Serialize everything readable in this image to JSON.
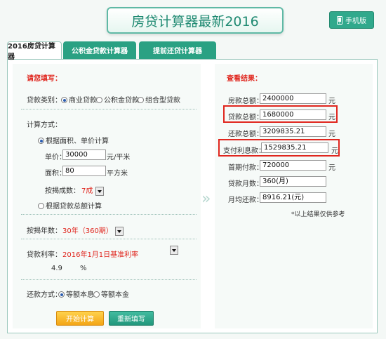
{
  "header": {
    "title": "房贷计算器最新2016",
    "mobile_label": "手机版"
  },
  "tabs": [
    {
      "label": "2016房贷计算器"
    },
    {
      "label": "公积金贷款计算器"
    },
    {
      "label": "提前还贷计算器"
    }
  ],
  "form": {
    "section_title": "请您填写：",
    "loan_type": {
      "label": "贷款类别：",
      "options": [
        "商业贷款",
        "公积金贷款",
        "组合型贷款"
      ]
    },
    "calc_method": {
      "label": "计算方式：",
      "option1": "根据面积、单价计算",
      "unit_price_label": "单价：",
      "unit_price_value": "30000",
      "unit_price_unit": "元/平米",
      "area_label": "面积：",
      "area_value": "80",
      "area_unit": "平方米",
      "down_label": "按揭成数：",
      "down_value": "7成",
      "option2": "根据贷款总额计算"
    },
    "years": {
      "label": "按揭年数：",
      "value": "30年（360期）"
    },
    "rate": {
      "label": "贷款利率：",
      "value": "2016年1月1日基准利率",
      "number": "4.9",
      "unit": "%"
    },
    "repay": {
      "label": "还款方式：",
      "options": [
        "等额本息",
        "等额本金"
      ]
    },
    "start_button": "开始计算",
    "reset_button": "重新填写"
  },
  "result": {
    "title": "查看结果：",
    "rows": [
      {
        "label": "房款总额：",
        "value": "2400000",
        "unit": "元"
      },
      {
        "label": "贷款总额：",
        "value": "1680000",
        "unit": "元"
      },
      {
        "label": "还款总额：",
        "value": "3209835.21",
        "unit": "元"
      },
      {
        "label": "支付利息款：",
        "value": "1529835.21",
        "unit": "元"
      },
      {
        "label": "首期付款：",
        "value": "720000",
        "unit": "元"
      },
      {
        "label": "贷款月数：",
        "value": "360(月)",
        "unit": ""
      },
      {
        "label": "月均还款：",
        "value": "8916.21(元)",
        "unit": ""
      }
    ],
    "note": "*以上结果仅供参考"
  }
}
